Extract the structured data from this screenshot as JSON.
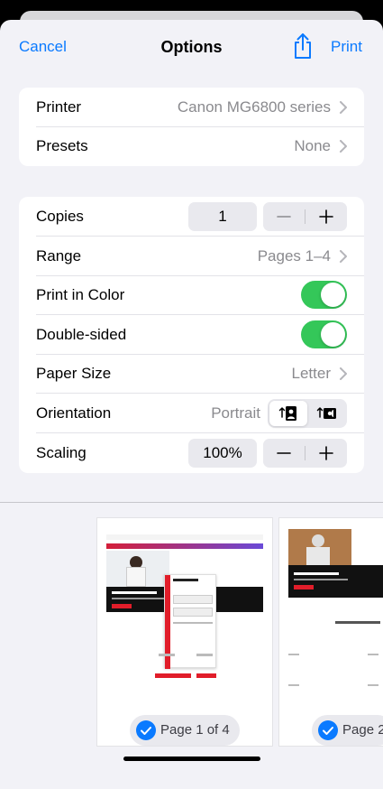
{
  "nav": {
    "cancel": "Cancel",
    "title": "Options",
    "share_icon": "share-icon",
    "print": "Print"
  },
  "printer_group": {
    "printer": {
      "label": "Printer",
      "value": "Canon MG6800 series"
    },
    "presets": {
      "label": "Presets",
      "value": "None"
    }
  },
  "options_group": {
    "copies": {
      "label": "Copies",
      "value": "1"
    },
    "range": {
      "label": "Range",
      "value": "Pages 1–4"
    },
    "print_in_color": {
      "label": "Print in Color",
      "on": true
    },
    "double_sided": {
      "label": "Double-sided",
      "on": true
    },
    "paper_size": {
      "label": "Paper Size",
      "value": "Letter"
    },
    "orientation": {
      "label": "Orientation",
      "value": "Portrait",
      "options": [
        "portrait-icon",
        "landscape-icon"
      ],
      "selected": "portrait-icon"
    },
    "scaling": {
      "label": "Scaling",
      "value": "100%"
    }
  },
  "preview": {
    "pages": [
      {
        "label": "Page 1 of 4",
        "selected": true
      },
      {
        "label": "Page 2",
        "selected": true
      }
    ]
  },
  "colors": {
    "accent": "#0a7aff",
    "toggle_on": "#34c759",
    "background": "#f2f2f7"
  }
}
